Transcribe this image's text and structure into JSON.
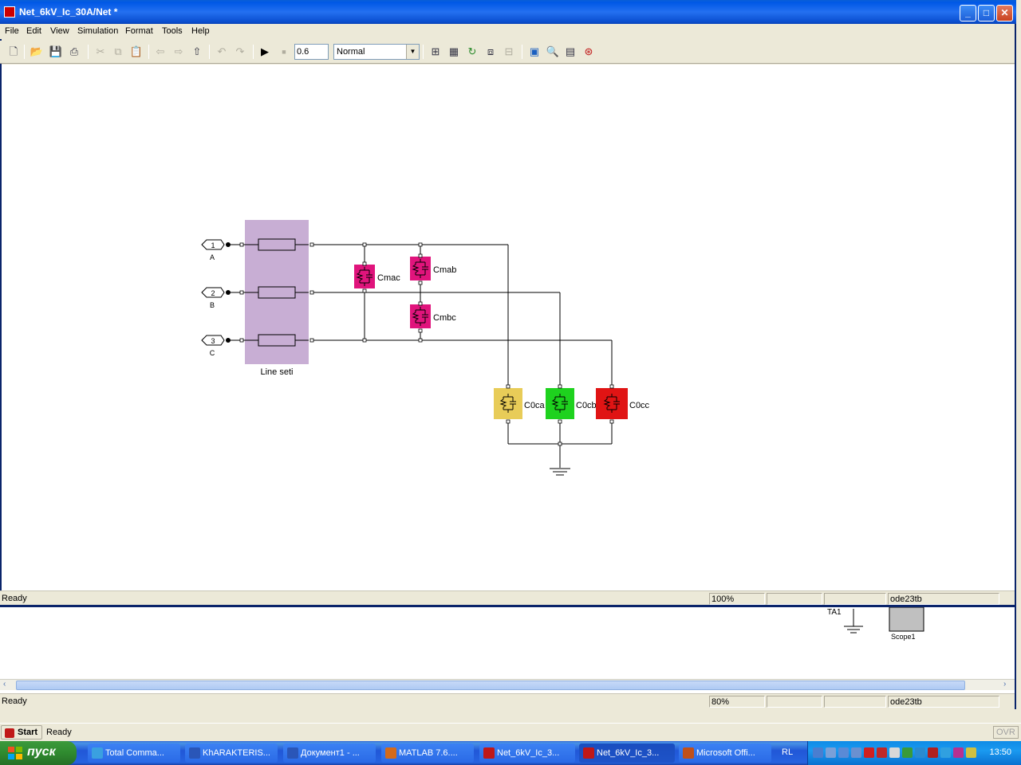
{
  "window": {
    "title": "Net_6kV_Ic_30A/Net *",
    "minimize": "_",
    "maximize": "□",
    "close": "✕"
  },
  "menu": [
    "File",
    "Edit",
    "View",
    "Simulation",
    "Format",
    "Tools",
    "Help"
  ],
  "toolbar": {
    "stop_time": "0.6",
    "sim_mode": "Normal"
  },
  "model": {
    "ports": [
      {
        "num": "1",
        "label": "A"
      },
      {
        "num": "2",
        "label": "B"
      },
      {
        "num": "3",
        "label": "C"
      }
    ],
    "line_block": "Line seti",
    "caps": [
      "Cmac",
      "Cmab",
      "Cmbc"
    ],
    "ground_caps": [
      "C0ca",
      "C0cb",
      "C0cc"
    ],
    "colors": {
      "line_block": "#c8aed4",
      "magenta": "#e0147c",
      "yellow": "#e8cc58",
      "green": "#1ed21e",
      "red": "#e01414"
    }
  },
  "main_status": {
    "text": "Ready",
    "zoom": "100%",
    "solver": "ode23tb"
  },
  "back_window": {
    "ta_label": "TA1",
    "scope_label": "Scope1",
    "status": "Ready",
    "zoom": "80%",
    "solver": "ode23tb"
  },
  "rtw": {
    "start": "Start",
    "status": "Ready",
    "ovr": "OVR"
  },
  "taskbar": {
    "start": "пуск",
    "tasks": [
      {
        "label": "Total Comma...",
        "color": "#3aa0e0"
      },
      {
        "label": "KhARAKTERIS...",
        "color": "#2a56b8"
      },
      {
        "label": "Документ1 - ...",
        "color": "#2a56b8"
      },
      {
        "label": "MATLAB  7.6....",
        "color": "#d46a1a"
      },
      {
        "label": "Net_6kV_Ic_3...",
        "color": "#c01818"
      },
      {
        "label": "Net_6kV_Ic_3...",
        "color": "#c01818"
      },
      {
        "label": "Microsoft Offi...",
        "color": "#c0501a"
      }
    ],
    "lang": "RL",
    "clock": "13:50"
  }
}
